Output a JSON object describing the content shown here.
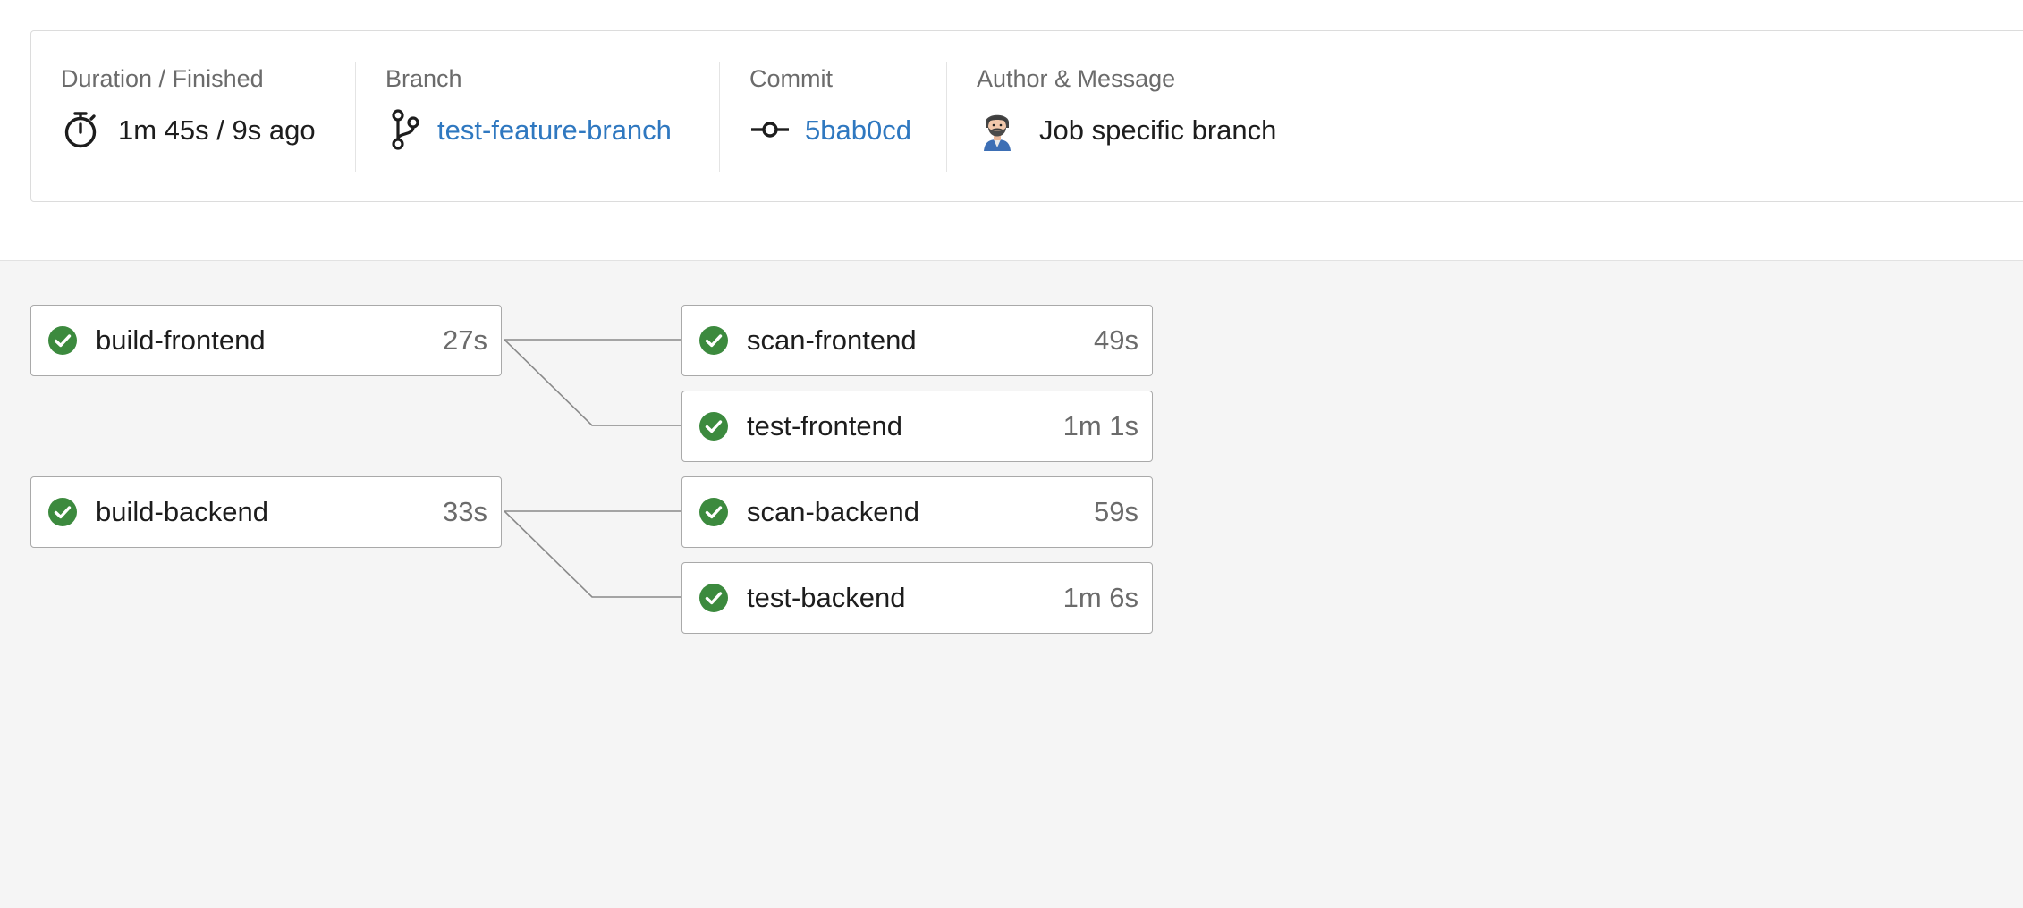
{
  "summary": {
    "duration": {
      "label": "Duration / Finished",
      "value": "1m 45s / 9s ago",
      "icon": "stopwatch-icon"
    },
    "branch": {
      "label": "Branch",
      "value": "test-feature-branch",
      "icon": "git-branch-icon"
    },
    "commit": {
      "label": "Commit",
      "value": "5bab0cd",
      "icon": "git-commit-icon"
    },
    "author": {
      "label": "Author & Message",
      "message": "Job specific branch",
      "icon": "author-avatar"
    }
  },
  "pipeline": {
    "jobs": [
      {
        "name": "build-frontend",
        "duration": "27s",
        "status": "success"
      },
      {
        "name": "scan-frontend",
        "duration": "49s",
        "status": "success"
      },
      {
        "name": "test-frontend",
        "duration": "1m 1s",
        "status": "success"
      },
      {
        "name": "build-backend",
        "duration": "33s",
        "status": "success"
      },
      {
        "name": "scan-backend",
        "duration": "59s",
        "status": "success"
      },
      {
        "name": "test-backend",
        "duration": "1m 6s",
        "status": "success"
      }
    ]
  },
  "colors": {
    "success": "#3c8a3e",
    "link": "#2f78c0",
    "graph_background": "#f5f5f5"
  }
}
